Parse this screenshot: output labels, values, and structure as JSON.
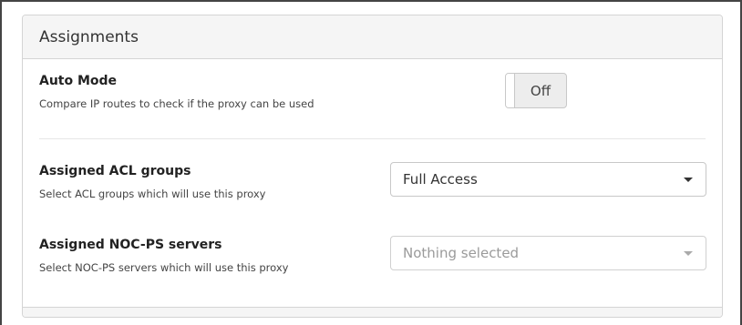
{
  "panel": {
    "title": "Assignments"
  },
  "auto_mode": {
    "title": "Auto Mode",
    "description": "Compare IP routes to check if the proxy can be used",
    "toggle_label": "Off"
  },
  "acl_groups": {
    "title": "Assigned ACL groups",
    "description": "Select ACL groups which will use this proxy",
    "selected": "Full Access"
  },
  "nocps_servers": {
    "title": "Assigned NOC-PS servers",
    "description": "Select NOC-PS servers which will use this proxy",
    "placeholder": "Nothing selected"
  },
  "icons": {
    "dropdown": "caret-down-icon"
  }
}
